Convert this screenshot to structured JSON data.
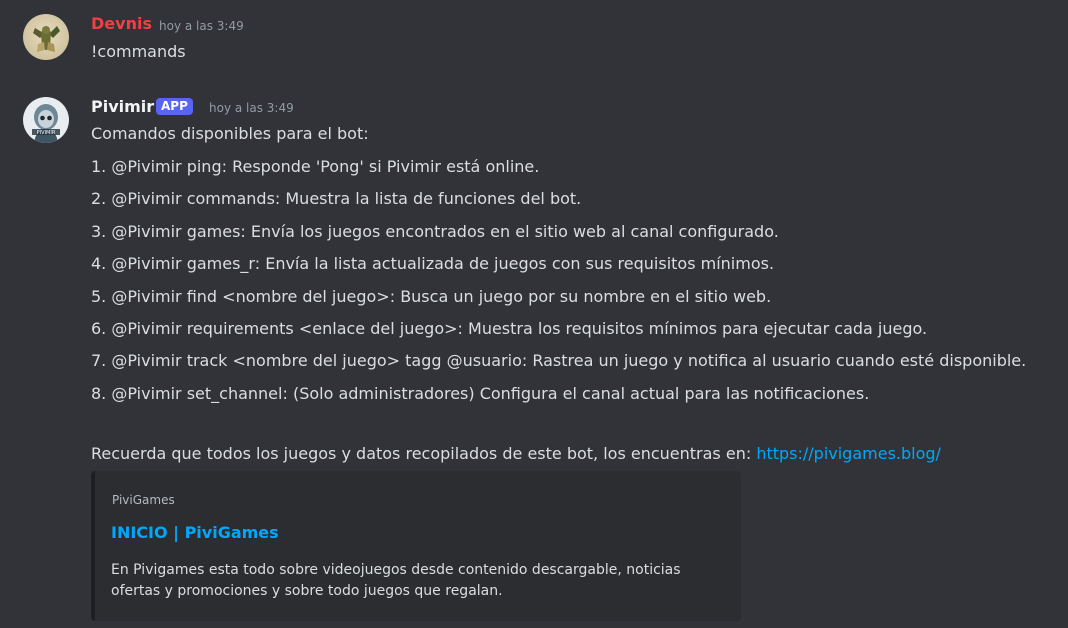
{
  "messages": [
    {
      "username": "Devnis",
      "username_color": "#f23f43",
      "timestamp": "hoy a las 3:49",
      "lines": [
        "!commands"
      ]
    },
    {
      "username": "Pivimir",
      "username_color": "#f2f3f5",
      "badge": "APP",
      "badge_color": "#5865f2",
      "timestamp": "hoy a las 3:49",
      "lines": [
        "Comandos disponibles para el bot:",
        "1. @Pivimir ping: Responde 'Pong' si Pivimir está online.",
        "2. @Pivimir commands: Muestra la lista de funciones del bot.",
        "3. @Pivimir games: Envía los juegos encontrados en el sitio web al canal configurado.",
        "4. @Pivimir games_r: Envía la lista actualizada de juegos con sus requisitos mínimos.",
        "5. @Pivimir find <nombre del juego>: Busca un juego por su nombre en el sitio web.",
        "6. @Pivimir requirements <enlace del juego>: Muestra los requisitos mínimos para ejecutar cada juego.",
        "7. @Pivimir track <nombre del juego> tagg @usuario: Rastrea un juego y notifica al usuario cuando esté disponible.",
        "8. @Pivimir set_channel: (Solo administradores) Configura el canal actual para las notificaciones."
      ],
      "footer_text": "Recuerda que todos los juegos y datos recopilados de este bot, los encuentras en: ",
      "footer_link": "https://pivigames.blog/",
      "embed": {
        "provider": "PiviGames",
        "title": "INICIO | PiviGames",
        "description": "En Pivigames esta todo sobre videojuegos desde contenido descargable, noticias ofertas y promociones y sobre todo juegos que regalan."
      }
    }
  ],
  "colors": {
    "background": "#313338",
    "text": "#dbdee1",
    "muted": "#949ba4",
    "link": "#00a8fc",
    "embed_bg": "#2b2d31"
  }
}
